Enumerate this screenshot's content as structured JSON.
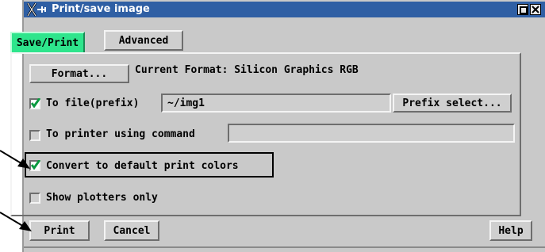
{
  "window": {
    "title": "Print/save image",
    "icon": "x-logo-icon",
    "controls": [
      "maximize-icon",
      "close-icon"
    ]
  },
  "tabs": [
    {
      "label": "Save/Print",
      "active": true
    },
    {
      "label": "Advanced",
      "active": false
    }
  ],
  "format": {
    "button_label": "Format...",
    "current_text": "Current Format: Silicon Graphics RGB"
  },
  "to_file": {
    "label": "To file(prefix)",
    "checked": true,
    "value": "~/img1",
    "prefix_button": "Prefix select..."
  },
  "to_printer": {
    "label": "To printer using command",
    "checked": false,
    "value": ""
  },
  "convert_colors": {
    "label": "Convert to default print colors",
    "checked": true
  },
  "show_plotters": {
    "label": "Show plotters only",
    "checked": false
  },
  "footer": {
    "print_label": "Print",
    "cancel_label": "Cancel",
    "help_label": "Help"
  },
  "colors": {
    "titlebar": "#2f5fa4",
    "active_tab": "#2ee58c",
    "check": "#0a9a40",
    "panel": "#cfcfcf"
  }
}
